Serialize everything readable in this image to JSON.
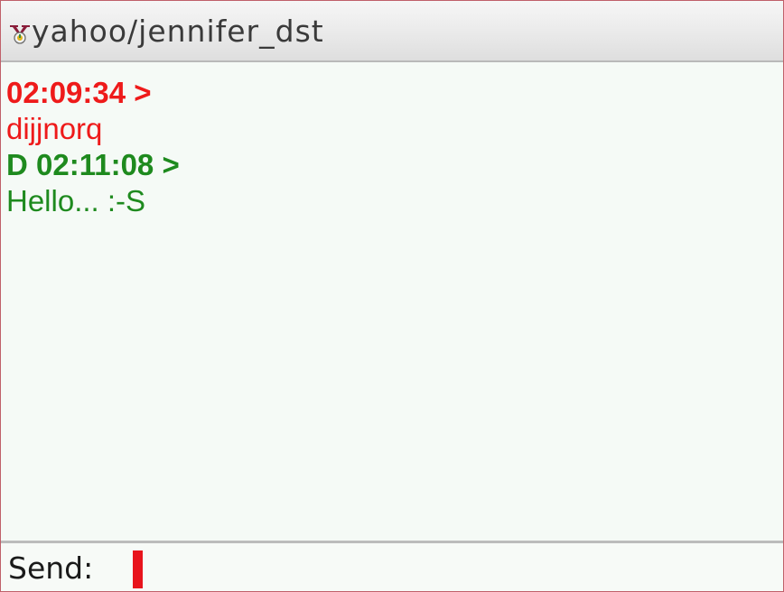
{
  "window": {
    "title": "yahoo/jennifer_dst",
    "icon": "yahoo-messenger-icon"
  },
  "messages": [
    {
      "header": "02:09:34 >",
      "text": "dijjnorq",
      "color": "#ee1a1a",
      "direction": "incoming"
    },
    {
      "header": "D 02:11:08 >",
      "text": "Hello... :-S",
      "color": "#1e8a1e",
      "direction": "outgoing"
    }
  ],
  "send": {
    "label": "Send:",
    "value": "",
    "caret_color": "#e8141c"
  },
  "colors": {
    "incoming": "#ee1a1a",
    "outgoing": "#1e8a1e",
    "window_border": "#c0606a"
  }
}
